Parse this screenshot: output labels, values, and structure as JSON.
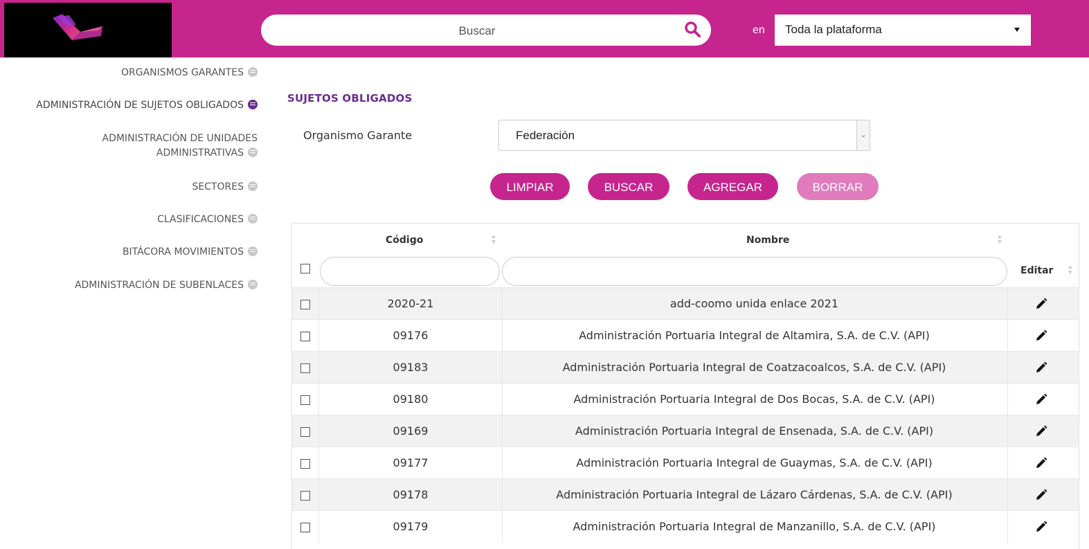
{
  "header": {
    "search_placeholder": "Buscar",
    "scope_label": "en",
    "scope_value": "Toda la plataforma",
    "brand_color": "#c6258e"
  },
  "sidebar": {
    "items": [
      {
        "label": "ORGANISMOS GARANTES",
        "active": false
      },
      {
        "label": "ADMINISTRACIÓN DE SUJETOS OBLIGADOS",
        "active": true
      },
      {
        "label_line1": "ADMINISTRACIÓN DE UNIDADES",
        "label_line2": "ADMINISTRATIVAS",
        "active": false
      },
      {
        "label": "SECTORES",
        "active": false
      },
      {
        "label": "CLASIFICACIONES",
        "active": false
      },
      {
        "label": "BITÁCORA MOVIMIENTOS",
        "active": false
      },
      {
        "label": "ADMINISTRACIÓN DE SUBENLACES",
        "active": false
      }
    ]
  },
  "main": {
    "title": "SUJETOS OBLIGADOS",
    "garante_label": "Organismo Garante",
    "garante_value": "Federación",
    "buttons": {
      "clear": "LIMPIAR",
      "search": "BUSCAR",
      "add": "AGREGAR",
      "delete": "BORRAR"
    },
    "accent_color": "#6b2c91"
  },
  "table": {
    "headers": {
      "code": "Código",
      "name": "Nombre",
      "edit": "Editar"
    },
    "rows": [
      {
        "code": "2020-21",
        "name": "add-coomo unida enlace 2021"
      },
      {
        "code": "09176",
        "name": "Administración Portuaria Integral de Altamira, S.A. de C.V. (API)"
      },
      {
        "code": "09183",
        "name": "Administración Portuaria Integral de Coatzacoalcos, S.A. de C.V. (API)"
      },
      {
        "code": "09180",
        "name": "Administración Portuaria Integral de Dos Bocas, S.A. de C.V. (API)"
      },
      {
        "code": "09169",
        "name": "Administración Portuaria Integral de Ensenada, S.A. de C.V. (API)"
      },
      {
        "code": "09177",
        "name": "Administración Portuaria Integral de Guaymas, S.A. de C.V. (API)"
      },
      {
        "code": "09178",
        "name": "Administración Portuaria Integral de Lázaro Cárdenas, S.A. de C.V. (API)"
      },
      {
        "code": "09179",
        "name": "Administración Portuaria Integral de Manzanillo, S.A. de C.V. (API)"
      }
    ]
  }
}
